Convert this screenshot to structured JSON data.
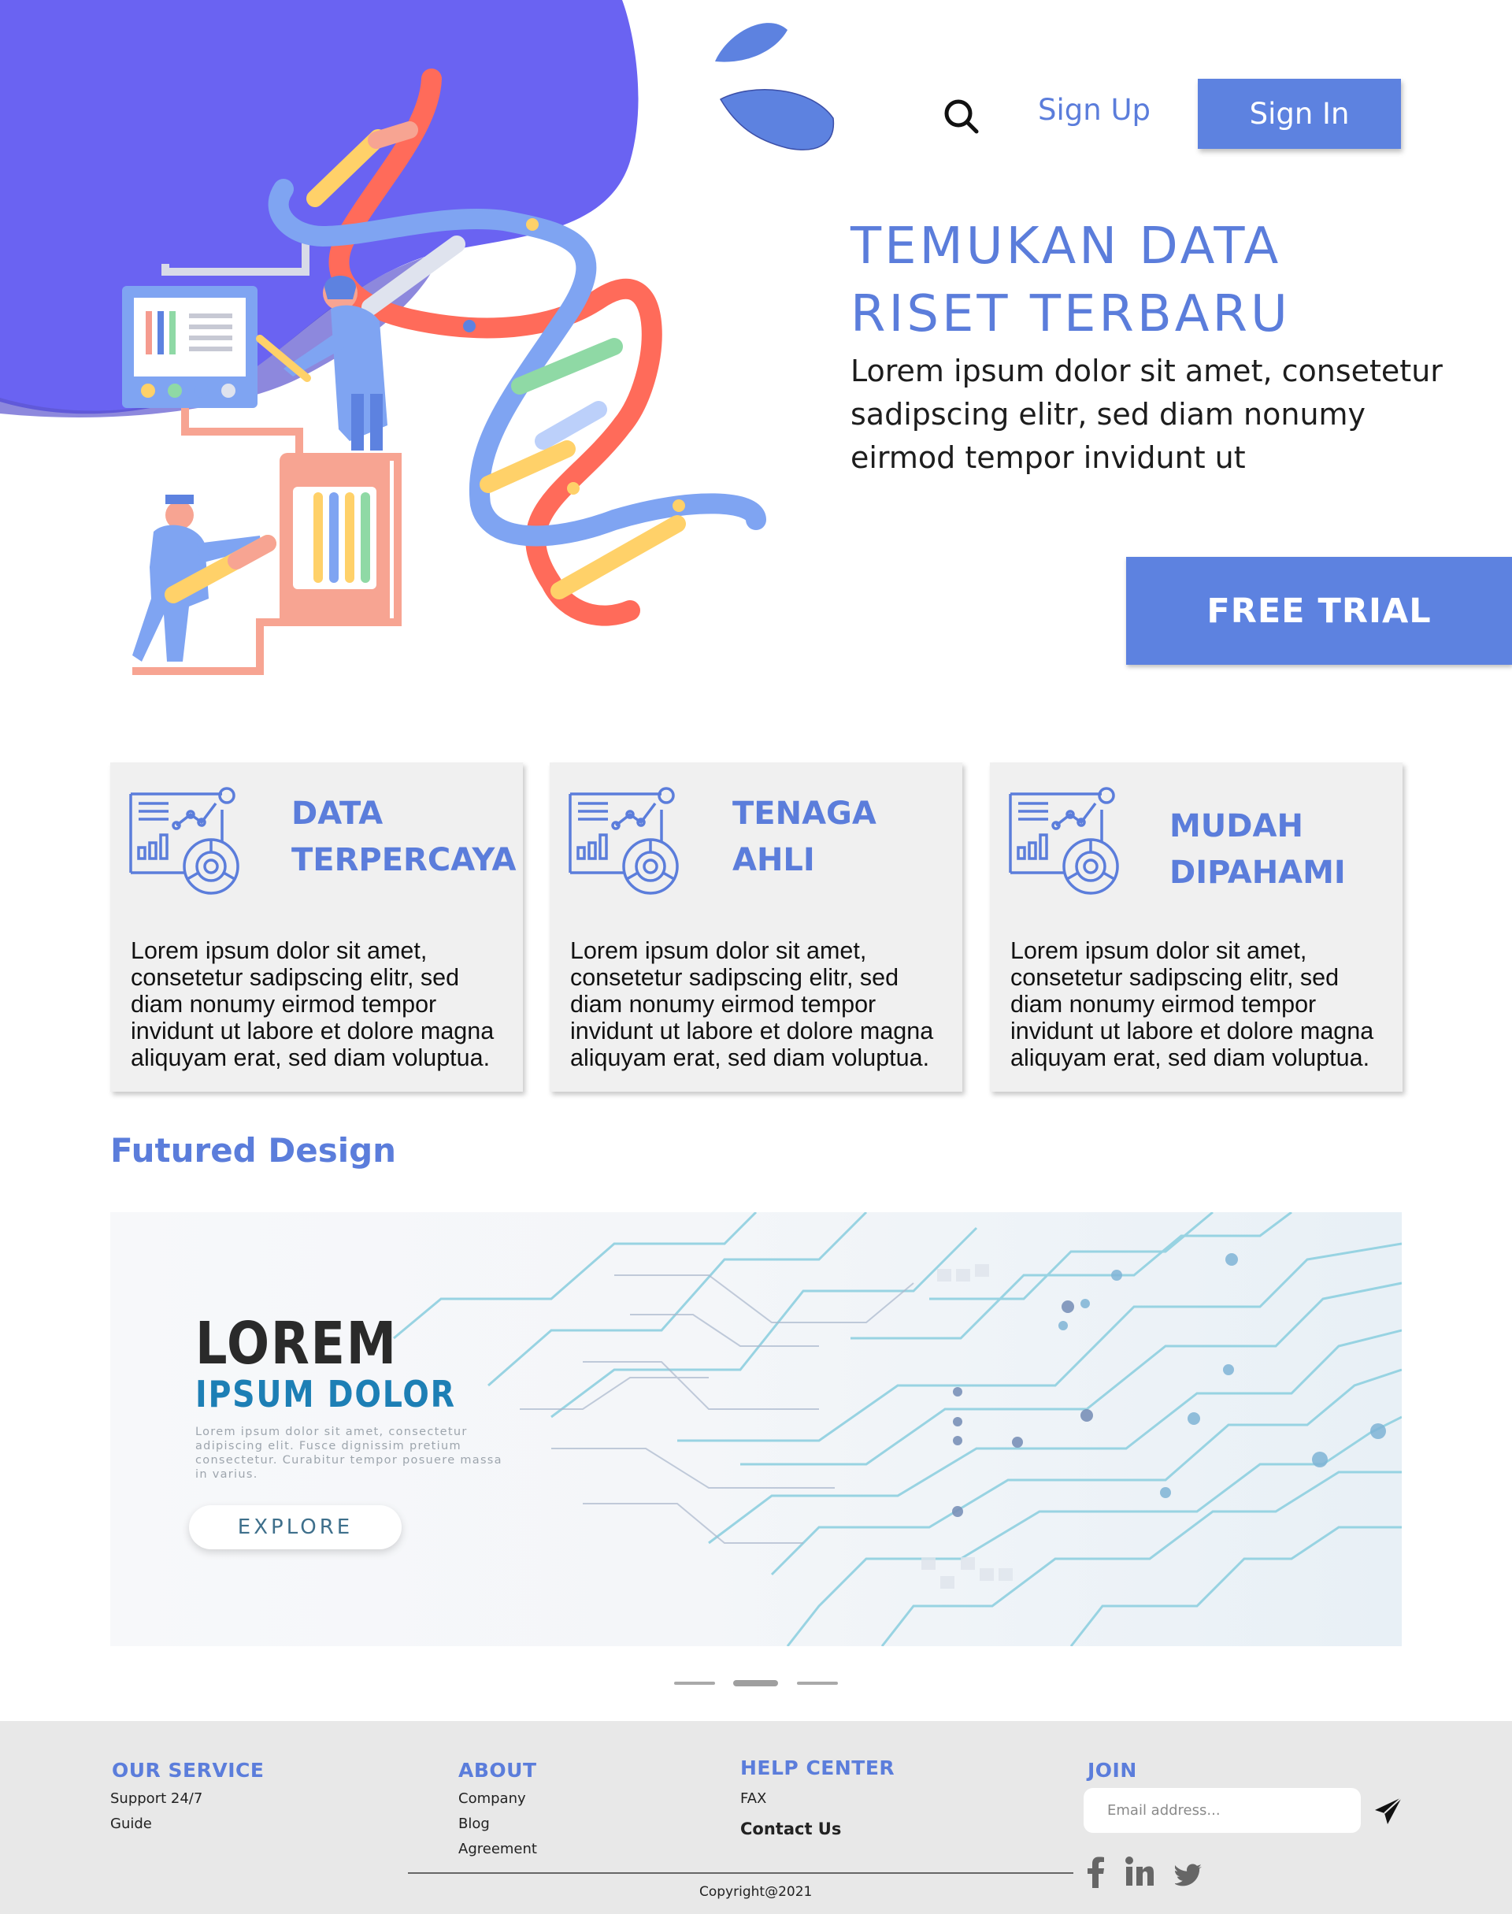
{
  "nav": {
    "search_icon": "search-icon",
    "signup_label": "Sign Up",
    "signin_label": "Sign In"
  },
  "hero": {
    "title": "TEMUKAN DATA RISET TERBARU",
    "description": "Lorem ipsum dolor sit amet, consetetur sadipscing elitr, sed diam nonumy eirmod tempor invidunt ut",
    "cta_label": "FREE TRIAL"
  },
  "features": [
    {
      "title_line1": "DATA",
      "title_line2": "TERPERCAYA",
      "description": "Lorem ipsum dolor sit amet, consetetur sadipscing elitr, sed diam nonumy eirmod tempor invidunt ut labore et dolore magna aliquyam erat, sed diam voluptua.",
      "icon": "analytics-dashboard-icon"
    },
    {
      "title_line1": "TENAGA",
      "title_line2": "AHLI",
      "description": "Lorem ipsum dolor sit amet, consetetur sadipscing elitr, sed diam nonumy eirmod tempor invidunt ut labore et dolore magna aliquyam erat, sed diam voluptua.",
      "icon": "analytics-dashboard-icon"
    },
    {
      "title_line1": "MUDAH",
      "title_line2": "DIPAHAMI",
      "description": "Lorem ipsum dolor sit amet, consetetur sadipscing elitr, sed diam nonumy eirmod tempor invidunt ut labore et dolore magna aliquyam erat, sed diam voluptua.",
      "icon": "analytics-dashboard-icon"
    }
  ],
  "featured": {
    "section_title": "Futured Design",
    "banner": {
      "heading": "LOREM",
      "subheading": "IPSUM DOLOR",
      "body": "Lorem ipsum dolor sit amet, consectetur adipiscing elit. Fusce dignissim pretium consectetur. Curabitur tempor posuere massa in varius.",
      "button_label": "EXPLORE"
    },
    "carousel": {
      "slides": 3,
      "active_index": 1
    }
  },
  "footer": {
    "our_service": {
      "heading": "OUR SERVICE",
      "links": [
        "Support 24/7",
        "Guide"
      ]
    },
    "about": {
      "heading": "ABOUT",
      "links": [
        "Company",
        "Blog",
        "Agreement"
      ]
    },
    "help_center": {
      "heading": "HELP CENTER",
      "links": [
        "FAX",
        "Contact Us"
      ]
    },
    "join": {
      "heading": "JOIN",
      "email_placeholder": "Email address...",
      "send_icon": "paper-plane-icon"
    },
    "social_icons": [
      "facebook-icon",
      "linkedin-icon",
      "twitter-icon"
    ],
    "copyright": "Copyright@2021"
  },
  "colors": {
    "accent": "#5d82e0",
    "hero_blob": "#6a63f2",
    "footer_bg": "#e8e8e8",
    "card_bg": "#f0f0f0",
    "banner_subheading": "#1d7fb5"
  }
}
